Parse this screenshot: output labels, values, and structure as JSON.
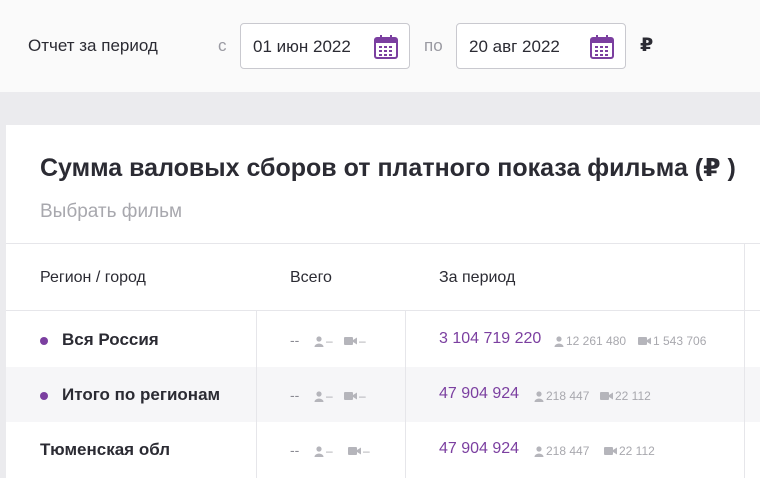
{
  "filters": {
    "label": "Отчет за период",
    "from_sep": "с",
    "date_from": "01 июн 2022",
    "to_sep": "по",
    "date_to": "20 авг 2022",
    "currency": "₽"
  },
  "card": {
    "title": "Сумма валовых сборов от платного показа фильма (₽ )",
    "film_placeholder": "Выбрать фильм"
  },
  "table": {
    "headers": [
      "Регион / город",
      "Всего",
      "За период"
    ],
    "rows": [
      {
        "name": "Вся Россия",
        "bullet": true,
        "total": "--",
        "total_people": "–",
        "total_screens": "–",
        "period": "3 104 719 220",
        "period_people": "12 261 480",
        "period_screens": "1 543 706"
      },
      {
        "name": "Итого по регионам",
        "bullet": true,
        "total": "--",
        "total_people": "–",
        "total_screens": "–",
        "period": "47 904 924",
        "period_people": "218 447",
        "period_screens": "22 112"
      },
      {
        "name": "Тюменская обл",
        "bullet": false,
        "total": "--",
        "total_people": "–",
        "total_screens": "–",
        "period": "47 904 924",
        "period_people": "218 447",
        "period_screens": "22 112"
      }
    ]
  },
  "colors": {
    "accent": "#7b3fa0",
    "muted": "#a8a8ae",
    "text": "#2b2b33"
  },
  "icons": {
    "calendar": "calendar-icon",
    "people": "person-icon",
    "screens": "camera-icon"
  }
}
